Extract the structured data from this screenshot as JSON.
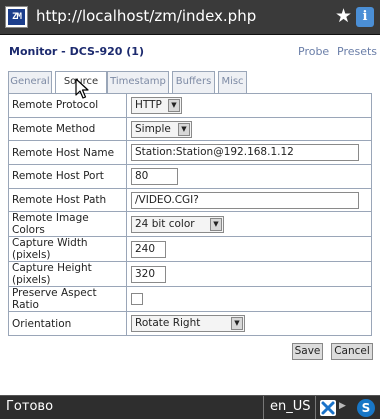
{
  "browser": {
    "logo_text": "ZM",
    "url": "http://localhost/zm/index.php",
    "star_icon": "star-icon",
    "info_icon": "info-icon"
  },
  "header": {
    "title": "Monitor - DCS-920 (1)",
    "links": [
      "Probe",
      "Presets"
    ]
  },
  "tabs": [
    {
      "label": "General",
      "active": false
    },
    {
      "label": "Source",
      "active": true
    },
    {
      "label": "Timestamp",
      "active": false
    },
    {
      "label": "Buffers",
      "active": false
    },
    {
      "label": "Misc",
      "active": false
    }
  ],
  "form": {
    "remote_protocol": {
      "label": "Remote Protocol",
      "value": "HTTP"
    },
    "remote_method": {
      "label": "Remote Method",
      "value": "Simple"
    },
    "remote_host_name": {
      "label": "Remote Host Name",
      "value": "Station:Station@192.168.1.12"
    },
    "remote_host_port": {
      "label": "Remote Host Port",
      "value": "80"
    },
    "remote_host_path": {
      "label": "Remote Host Path",
      "value": "/VIDEO.CGI?"
    },
    "remote_image_colors": {
      "label": "Remote Image Colors",
      "value": "24 bit color"
    },
    "capture_width": {
      "label": "Capture Width (pixels)",
      "value": "240"
    },
    "capture_height": {
      "label": "Capture Height (pixels)",
      "value": "320"
    },
    "preserve_aspect_ratio": {
      "label": "Preserve Aspect Ratio",
      "checked": false
    },
    "orientation": {
      "label": "Orientation",
      "value": "Rotate Right"
    }
  },
  "buttons": {
    "save": "Save",
    "cancel": "Cancel"
  },
  "statusbar": {
    "status": "Готово",
    "locale": "en_US",
    "s_icon_letter": "S"
  },
  "colors": {
    "title_blue": "#1c2a6e",
    "link_blue": "#6a7ea8",
    "chrome_dark": "#3a3a3a"
  }
}
